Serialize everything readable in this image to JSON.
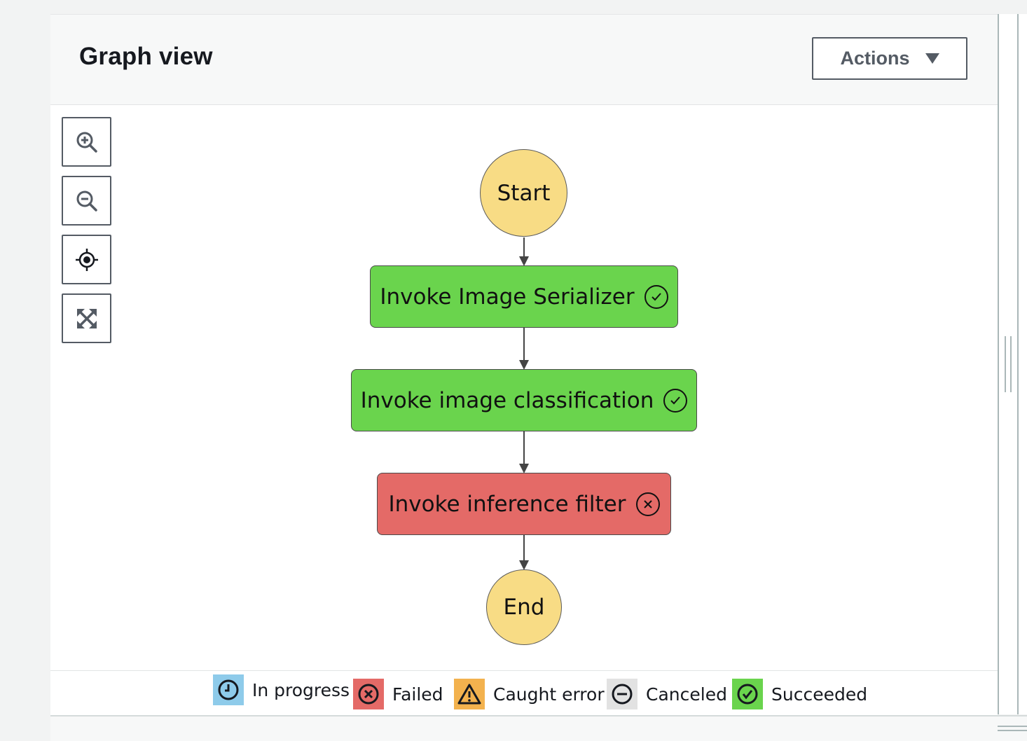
{
  "header": {
    "title": "Graph view",
    "actions_label": "Actions"
  },
  "toolbar": {
    "buttons": [
      "zoom-in-icon",
      "zoom-out-icon",
      "center-icon",
      "fit-to-screen-icon"
    ]
  },
  "graph": {
    "start_label": "Start",
    "end_label": "End",
    "states": [
      {
        "label": "Invoke Image Serializer",
        "status": "Succeeded"
      },
      {
        "label": "Invoke image classification",
        "status": "Succeeded"
      },
      {
        "label": "Invoke inference filter",
        "status": "Failed"
      }
    ]
  },
  "legend": {
    "items": [
      {
        "label": "In progress",
        "icon": "clock-icon",
        "color": "#8ecbea"
      },
      {
        "label": "Failed",
        "icon": "x-circle-icon",
        "color": "#e46a67"
      },
      {
        "label": "Caught error",
        "icon": "warning-icon",
        "color": "#f3b24e"
      },
      {
        "label": "Canceled",
        "icon": "minus-circle-icon",
        "color": "#e2e2e2"
      },
      {
        "label": "Succeeded",
        "icon": "check-circle-icon",
        "color": "#6ad44d"
      }
    ]
  },
  "colors": {
    "start_end_fill": "#f8dc85",
    "succeeded_fill": "#6ad44d",
    "failed_fill": "#e46a67"
  }
}
